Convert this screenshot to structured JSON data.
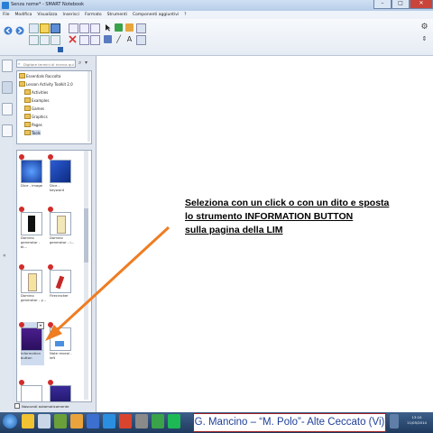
{
  "window": {
    "title": "Senza nome* - SMART Notebook",
    "min": "–",
    "max": "□",
    "close": "✕"
  },
  "menu": [
    "File",
    "Modifica",
    "Visualizza",
    "Inserisci",
    "Formato",
    "Strumenti",
    "Componenti aggiuntivi",
    "?"
  ],
  "sidebar": {
    "search_placeholder": "Digitare termini di ricerca qui",
    "tree": [
      "Essentials Raccolta",
      "Lesson Activity Toolkit 2.0",
      "Activities",
      "Examples",
      "Games",
      "Graphics",
      "Pages",
      "Tools"
    ],
    "gallery": [
      {
        "label": "Dice - image"
      },
      {
        "label": "Dice - keyword"
      },
      {
        "label": "Domino generator - bl..."
      },
      {
        "label": "Domino generator - i..."
      },
      {
        "label": "Domino generator - y..."
      },
      {
        "label": "Firecracker"
      },
      {
        "label": "Information button"
      },
      {
        "label": "Note reveal - left"
      }
    ],
    "auto_hide": "Nascondi automaticamente"
  },
  "canvas": {
    "instruction_lines": [
      "Seleziona con un click o con un dito e sposta",
      "lo strumento INFORMATION BUTTON",
      "sulla pagina della LIM"
    ]
  },
  "taskbar": {
    "credit": "G. Mancino – “M. Polo”- Alte Ceccato (Vi)",
    "time": "13:10",
    "date": "11/05/2014"
  },
  "colors": {
    "arrow": "#ef7d22",
    "credit_text": "#1f3f9a",
    "credit_border": "#a02020"
  }
}
